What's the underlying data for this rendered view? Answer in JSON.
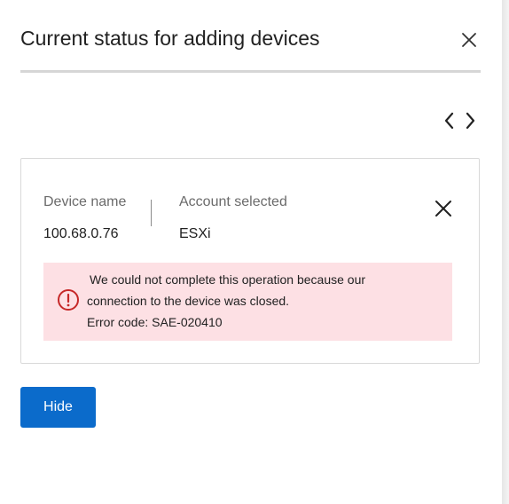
{
  "dialog": {
    "title": "Current status for adding devices",
    "close_icon": "close-icon",
    "prev_icon": "chevron-left-icon",
    "next_icon": "chevron-right-icon"
  },
  "device_card": {
    "device_name_label": "Device name",
    "device_name_value": "100.68.0.76",
    "account_label": "Account selected",
    "account_value": "ESXi",
    "dismiss_icon": "close-icon",
    "error": {
      "icon": "error-exclamation-icon",
      "line1": "We could not complete this operation because our",
      "line2": "connection to the device was closed.",
      "code": "Error code: SAE-020410",
      "background": "#fde0e4",
      "icon_color": "#c62828"
    }
  },
  "actions": {
    "hide_label": "Hide",
    "accent": "#0b6bcb"
  }
}
